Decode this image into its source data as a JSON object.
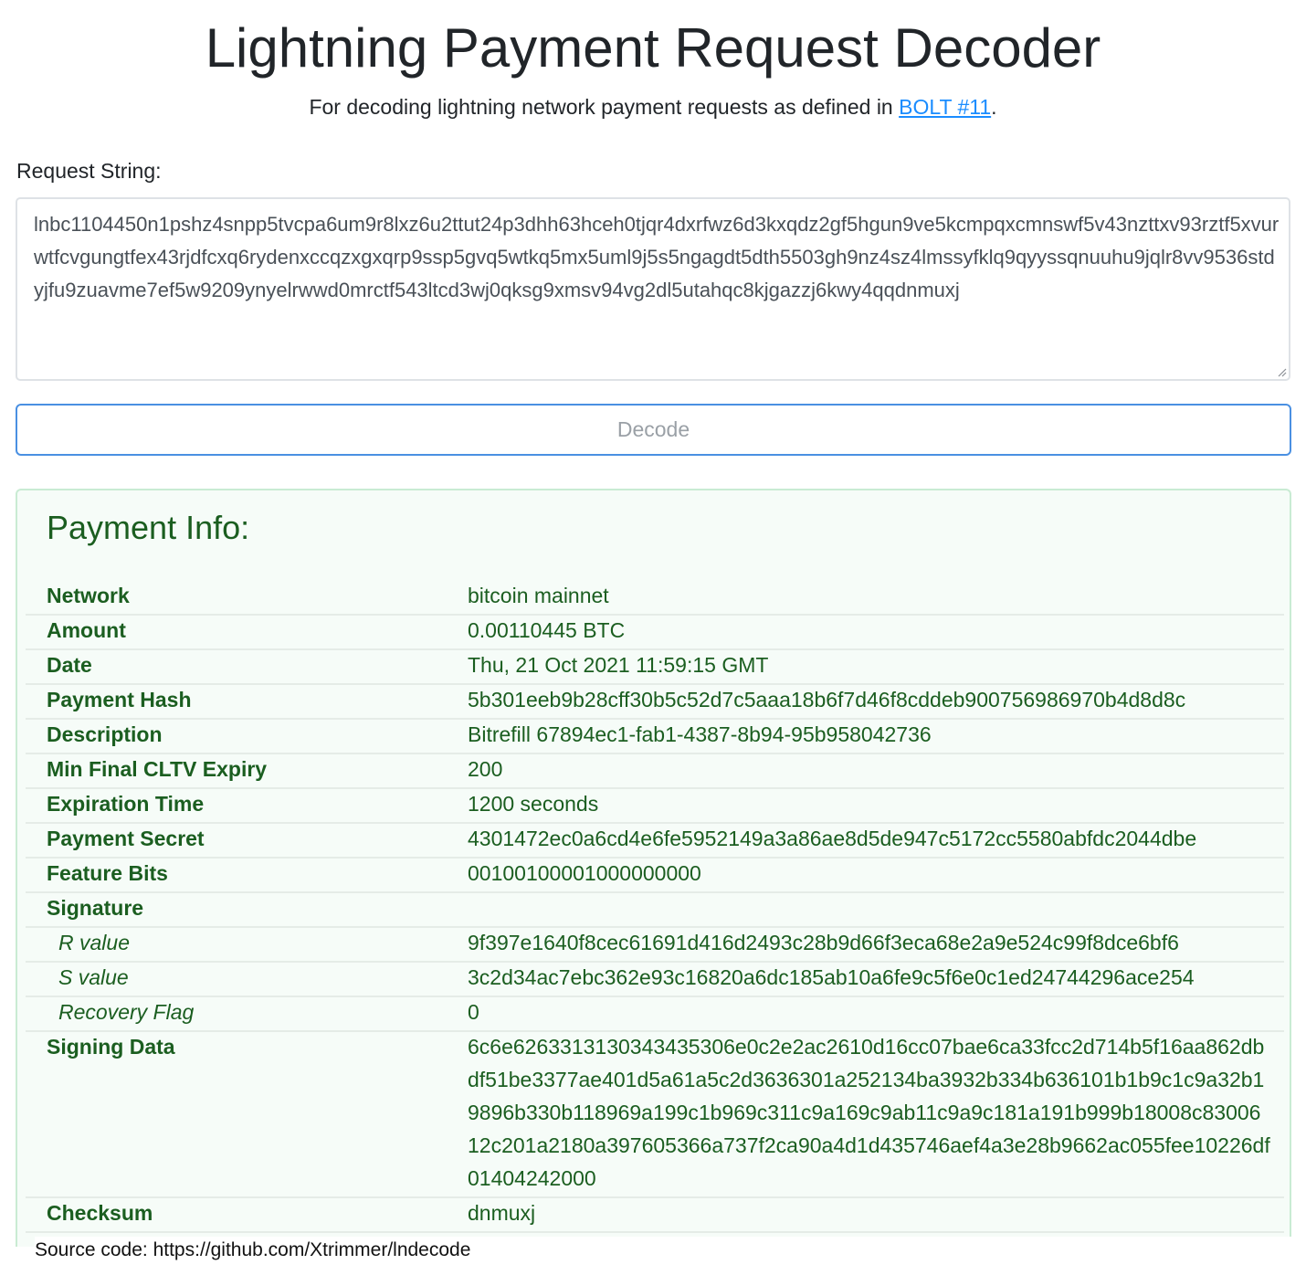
{
  "header": {
    "title": "Lightning Payment Request Decoder",
    "subtitle_prefix": "For decoding lightning network payment requests as defined in ",
    "subtitle_link": "BOLT #11",
    "subtitle_suffix": "."
  },
  "request": {
    "label": "Request String:",
    "value": "lnbc1104450n1pshz4snpp5tvcpa6um9r8lxz6u2ttut24p3dhh63hceh0tjqr4dxrfwz6d3kxqdz2gf5hgun9ve5kcmpqxcmnswf5v43nzttxv93rztf5xvurwtfcvgungtfex43rjdfcxq6rydenxccqzxgxqrp9ssp5gvq5wtkq5mx5uml9j5s5ngagdt5dth5503gh9nz4sz4lmssyfklq9qyyssqnuuhu9jqlr8vv9536stdyjfu9zuavme7ef5w9209ynyelrwwd0mrctf543ltcd3wj0qksg9xmsv94vg2dl5utahqc8kjgazzj6kwy4qqdnmuxj"
  },
  "decode_button": "Decode",
  "payment_info": {
    "title": "Payment Info:",
    "rows": [
      {
        "key": "Network",
        "value": "bitcoin mainnet",
        "sub": false
      },
      {
        "key": "Amount",
        "value": "0.00110445 BTC",
        "sub": false
      },
      {
        "key": "Date",
        "value": "Thu, 21 Oct 2021 11:59:15 GMT",
        "sub": false
      },
      {
        "key": "Payment Hash",
        "value": "5b301eeb9b28cff30b5c52d7c5aaa18b6f7d46f8cddeb900756986970b4d8d8c",
        "sub": false
      },
      {
        "key": "Description",
        "value": "Bitrefill 67894ec1-fab1-4387-8b94-95b958042736",
        "sub": false
      },
      {
        "key": "Min Final CLTV Expiry",
        "value": "200",
        "sub": false
      },
      {
        "key": "Expiration Time",
        "value": "1200 seconds",
        "sub": false
      },
      {
        "key": "Payment Secret",
        "value": "4301472ec0a6cd4e6fe5952149a3a86ae8d5de947c5172cc5580abfdc2044dbe",
        "sub": false
      },
      {
        "key": "Feature Bits",
        "value": "00100100001000000000",
        "sub": false
      },
      {
        "key": "Signature",
        "value": "",
        "sub": false
      },
      {
        "key": "R value",
        "value": "9f397e1640f8cec61691d416d2493c28b9d66f3eca68e2a9e524c99f8dce6bf6",
        "sub": true
      },
      {
        "key": "S value",
        "value": "3c2d34ac7ebc362e93c16820a6dc185ab10a6fe9c5f6e0c1ed24744296ace254",
        "sub": true
      },
      {
        "key": "Recovery Flag",
        "value": "0",
        "sub": true
      },
      {
        "key": "Signing Data",
        "value": "6c6e6263313130343435306e0c2e2ac2610d16cc07bae6ca33fcc2d714b5f16aa862dbdf51be3377ae401d5a61a5c2d3636301a252134ba3932b334b636101b1b9c1c9a32b19896b330b118969a199c1b969c311c9a169c9ab11c9a9c181a191b999b18008c8300612c201a2180a397605366a737f2ca90a4d1d435746aef4a3e28b9662ac055fee10226df01404242000",
        "sub": false
      },
      {
        "key": "Checksum",
        "value": "dnmuxj",
        "sub": false
      }
    ]
  },
  "footer": {
    "text": "Source code: https://github.com/Xtrimmer/lndecode"
  }
}
